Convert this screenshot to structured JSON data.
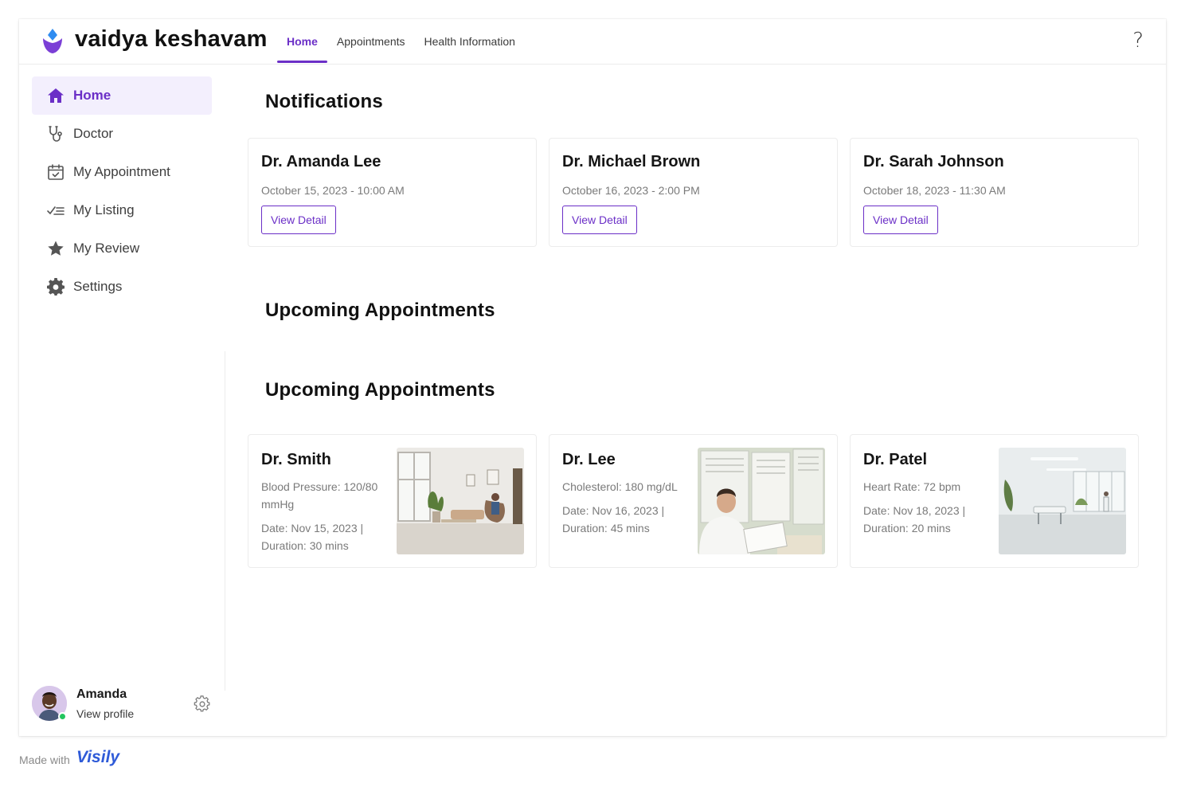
{
  "app": {
    "brand": "vaidya keshavam",
    "accent_color": "#6b2fc7",
    "logo_icon": "drop-lotus-logo"
  },
  "nav": {
    "tabs": [
      {
        "label": "Home",
        "active": true
      },
      {
        "label": "Appointments",
        "active": false
      },
      {
        "label": "Health Information",
        "active": false
      }
    ],
    "help_label": "?"
  },
  "sidebar": {
    "items": [
      {
        "label": "Home",
        "icon": "home-icon",
        "active": true
      },
      {
        "label": "Doctor",
        "icon": "stethoscope-icon",
        "active": false
      },
      {
        "label": "My Appointment",
        "icon": "calendar-check-icon",
        "active": false
      },
      {
        "label": "My Listing",
        "icon": "checklist-icon",
        "active": false
      },
      {
        "label": "My Review",
        "icon": "star-icon",
        "active": false
      },
      {
        "label": "Settings",
        "icon": "gear-icon",
        "active": false
      }
    ],
    "profile": {
      "name": "Amanda",
      "link": "View profile",
      "status": "online"
    }
  },
  "notifications": {
    "title": "Notifications",
    "cards": [
      {
        "doctor": "Dr. Amanda Lee",
        "datetime": "October 15, 2023 - 10:00 AM",
        "button": "View Detail"
      },
      {
        "doctor": "Dr. Michael Brown",
        "datetime": "October 16, 2023 - 2:00 PM",
        "button": "View Detail"
      },
      {
        "doctor": "Dr. Sarah Johnson",
        "datetime": "October 18, 2023 - 11:30 AM",
        "button": "View Detail"
      }
    ]
  },
  "upcoming_heading_1": "Upcoming Appointments",
  "upcoming": {
    "title": "Upcoming Appointments",
    "cards": [
      {
        "doctor": "Dr. Smith",
        "metric": "Blood Pressure: 120/80 mmHg",
        "date": "Date: Nov 15, 2023 | Duration: 30 mins",
        "image": "waiting-room-photo"
      },
      {
        "doctor": "Dr. Lee",
        "metric": "Cholesterol: 180 mg/dL",
        "date": "Date: Nov 16, 2023 | Duration: 45 mins",
        "image": "doctor-reviewing-charts-photo"
      },
      {
        "doctor": "Dr. Patel",
        "metric": "Heart Rate: 72 bpm",
        "date": "Date: Nov 18, 2023 | Duration: 20 mins",
        "image": "clinic-interior-photo"
      }
    ]
  },
  "footer": {
    "made_with": "Made with",
    "brand": "Visily"
  }
}
